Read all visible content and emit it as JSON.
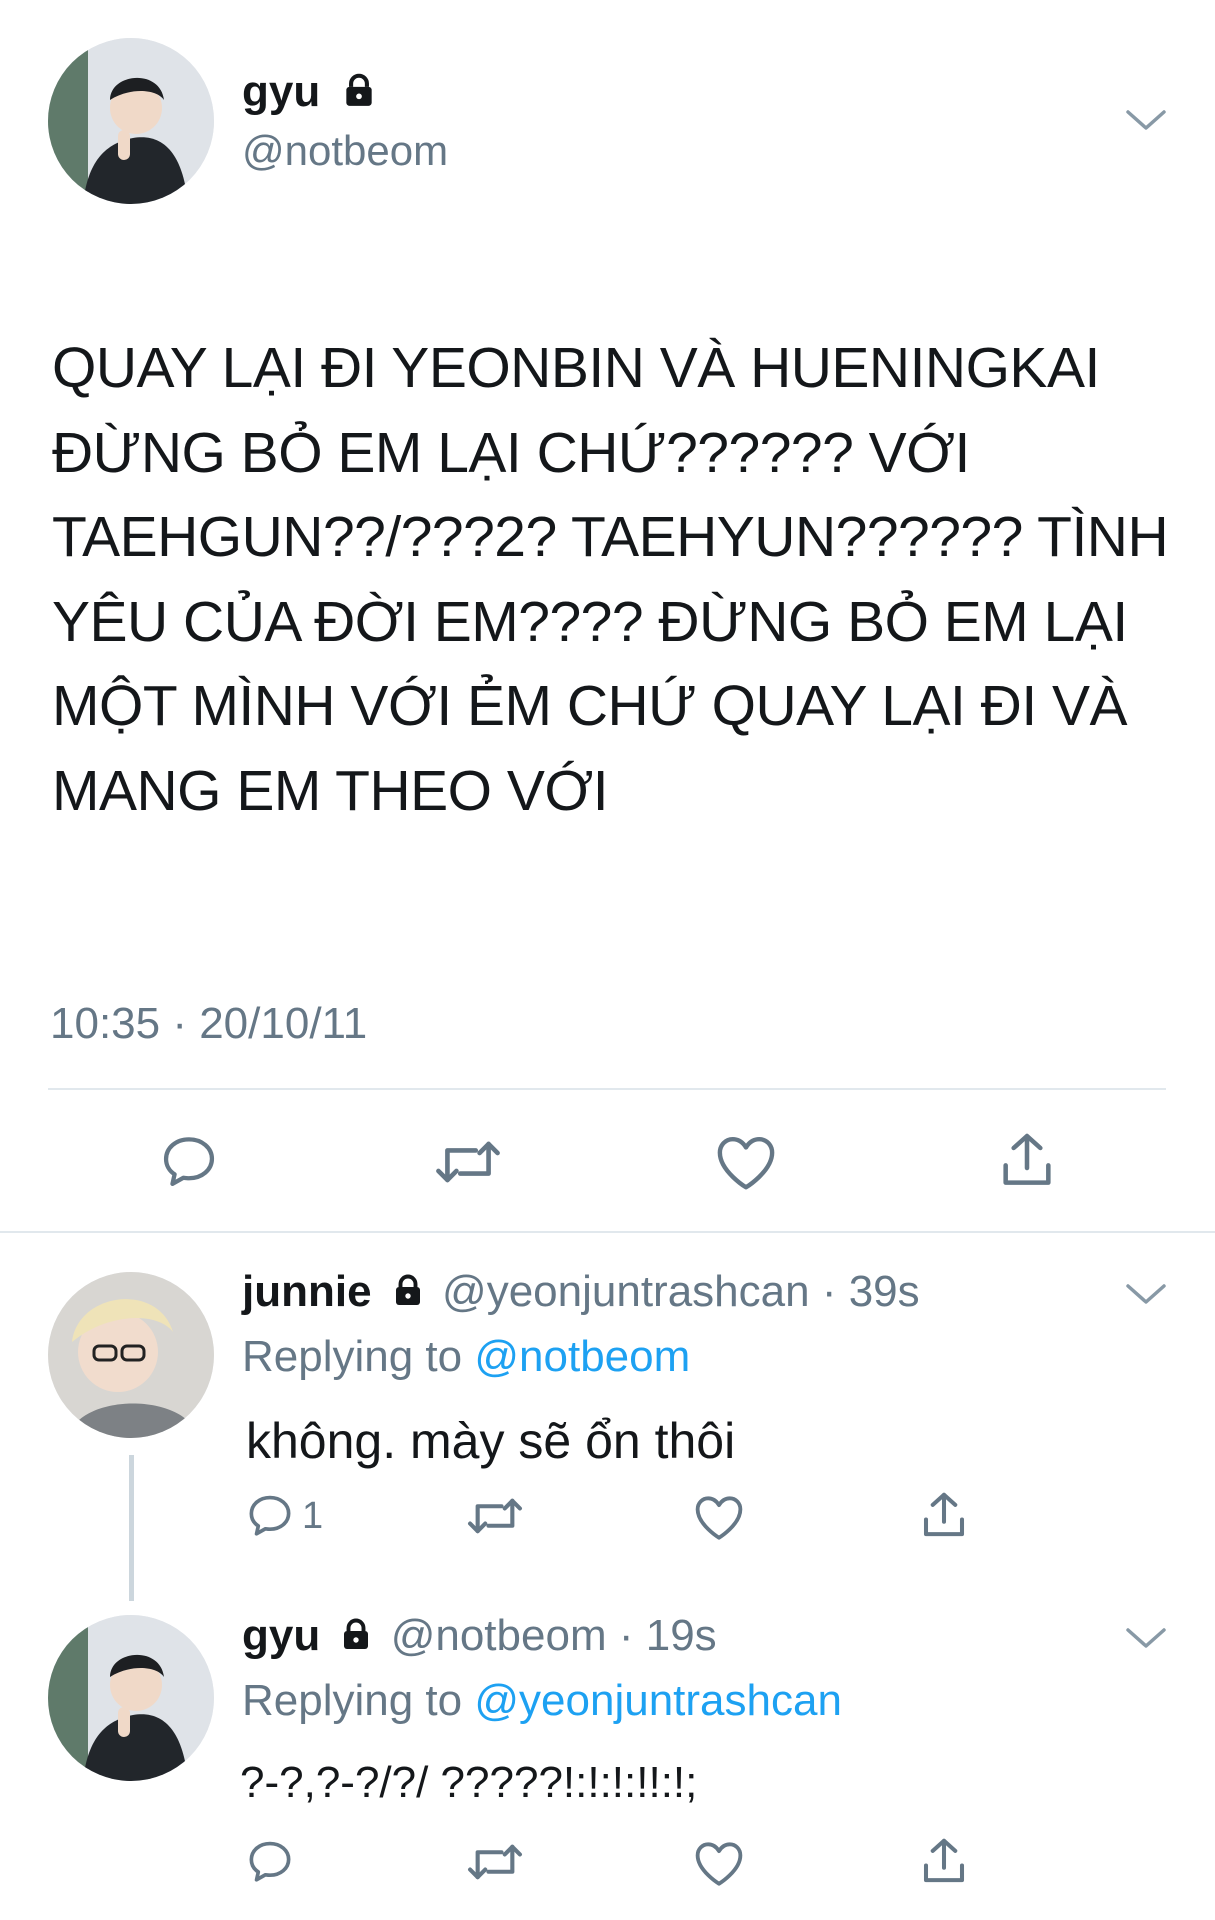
{
  "main_tweet": {
    "display_name": "gyu",
    "handle": "@notbeom",
    "text": "QUAY LẠI ĐI YEONBIN VÀ HUENINGKAI ĐỪNG BỎ EM LẠI CHỨ?????? VỚI TAEHGUN??/???2? TAEHYUN?????? TÌNH YÊU CỦA ĐỜI EM???? ĐỪNG BỎ EM LẠI MỘT MÌNH VỚI ẺM CHỨ QUAY LẠI ĐI VÀ MANG EM THEO VỚI",
    "text_lines": [
      "QUAY LẠI ĐI YEONBIN VÀ HUENINGKAI",
      "ĐỪNG BỎ EM LẠI CHỨ?????? VỚI",
      "TAEHGUN??/???2? TAEHYUN?????? TÌNH",
      "YÊU CỦA ĐỜI EM???? ĐỪNG BỎ EM LẠI",
      "MỘT MÌNH VỚI ẺM CHỨ QUAY LẠI ĐI VÀ",
      "MANG EM THEO VỚI"
    ],
    "timestamp": "10:35 · 20/10/11"
  },
  "reply1": {
    "display_name": "junnie",
    "handle": "@yeonjuntrashcan",
    "time": "· 39s",
    "replying_label": "Replying to",
    "replying_to": "@notbeom",
    "text": "không. mày sẽ ổn thôi",
    "reply_count": "1"
  },
  "reply2": {
    "display_name": "gyu",
    "handle": "@notbeom",
    "time": "· 19s",
    "replying_label": "Replying to",
    "replying_to": "@yeonjuntrashcan",
    "text": "?-?,?-?/?/ ?????!:!:!:!!:!;"
  },
  "icons": [
    "chevron-down-icon",
    "lock-icon",
    "reply-icon",
    "retweet-icon",
    "like-icon",
    "share-icon"
  ],
  "colors": {
    "link": "#1da1f2",
    "muted": "#657786",
    "icon": "#657786",
    "divider": "#e1e8ed"
  }
}
